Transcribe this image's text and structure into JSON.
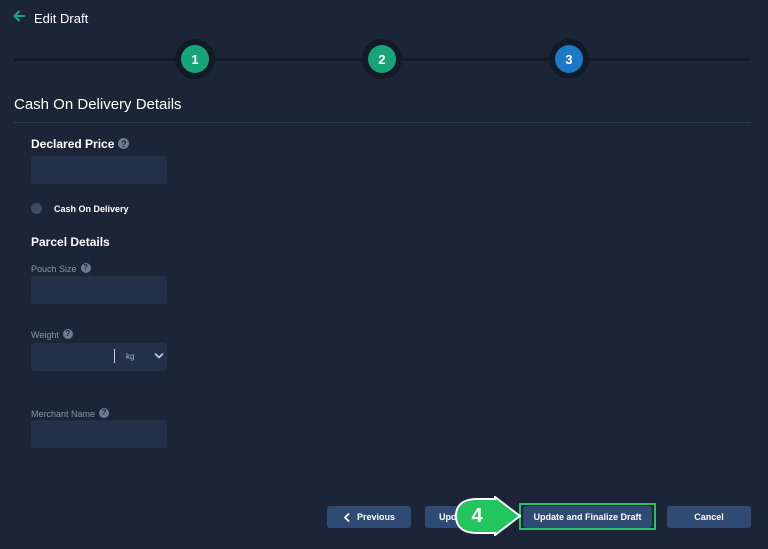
{
  "header": {
    "title": "Edit Draft",
    "back_icon": "arrow-left-icon"
  },
  "stepper": {
    "steps": [
      "1",
      "2",
      "3"
    ],
    "active_step": "3"
  },
  "section": {
    "title": "Cash On Delivery Details"
  },
  "declared_price": {
    "label": "Declared Price",
    "value": ""
  },
  "cod": {
    "label": "Cash On Delivery",
    "checked": false
  },
  "parcel": {
    "title": "Parcel Details",
    "pouch_size_label": "Pouch Size",
    "pouch_size_value": "",
    "weight_label": "Weight",
    "weight_value": "",
    "weight_unit": "kg",
    "merchant_name_label": "Merchant Name",
    "merchant_name_value": ""
  },
  "buttons": {
    "previous": "Previous",
    "update_partial": "Upd",
    "update_finalize": "Update and Finalize Draft",
    "cancel": "Cancel"
  },
  "callout": {
    "number": "4"
  },
  "colors": {
    "background": "#1c2537",
    "step_done": "#17a478",
    "step_active": "#1e78c8",
    "button": "#2f4b73",
    "highlight": "#22c55e"
  }
}
